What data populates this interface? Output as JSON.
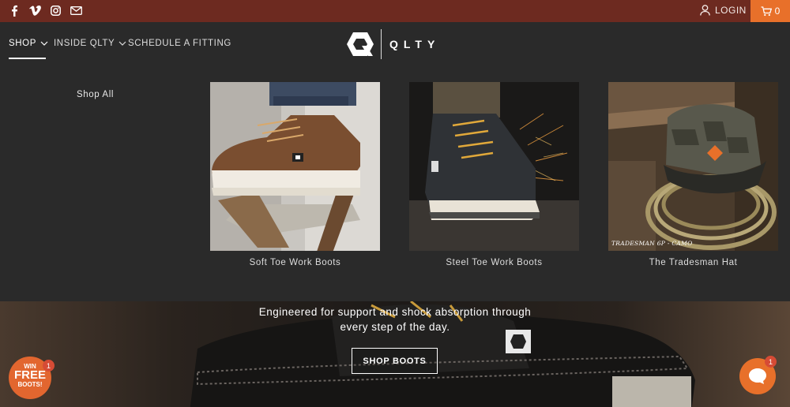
{
  "topbar": {
    "social": [
      "facebook-icon",
      "vimeo-icon",
      "instagram-icon",
      "email-icon"
    ],
    "login_label": "LOGIN",
    "cart_count": "0",
    "bg_color": "#6d2a20",
    "cart_color": "#e8702a"
  },
  "nav": {
    "items": [
      {
        "label": "SHOP",
        "active": true,
        "has_dropdown": true
      },
      {
        "label": "INSIDE QLTY",
        "active": false,
        "has_dropdown": true
      },
      {
        "label": "SCHEDULE A FITTING",
        "active": false,
        "has_dropdown": false
      }
    ],
    "logo_text": "QLTY"
  },
  "mega_menu": {
    "shop_all_label": "Shop All",
    "products": [
      {
        "caption": "Soft Toe Work Boots"
      },
      {
        "caption": "Steel Toe Work Boots"
      },
      {
        "caption": "The Tradesman Hat",
        "image_text": "TRADESMAN 6P - CAMO"
      }
    ]
  },
  "hero": {
    "tagline": "Engineered for support and shock absorption through every step of the day.",
    "cta_label": "SHOP BOOTS"
  },
  "promo": {
    "line1": "WIN",
    "line2": "FREE",
    "line3": "BOOTS!",
    "badge": "1"
  },
  "chat": {
    "badge": "1"
  }
}
